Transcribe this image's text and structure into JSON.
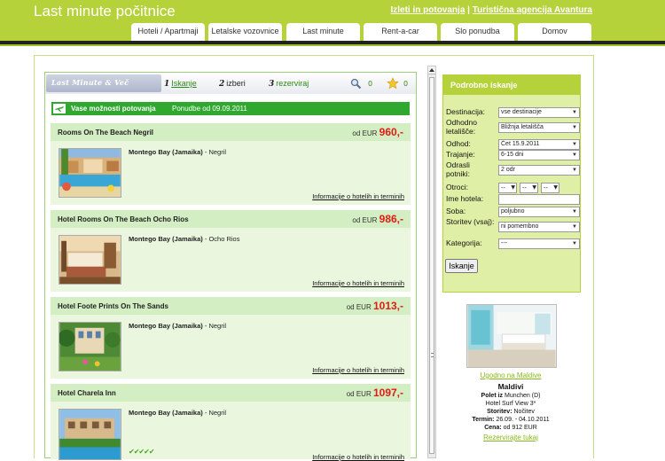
{
  "header": {
    "site_title": "Last minute počitnice",
    "links": [
      {
        "label": "Izleti in potovanja"
      },
      {
        "label": "Turistična agencija Avantura"
      }
    ],
    "separator": "|",
    "tabs": [
      {
        "label": "Hoteli / Apartmaji"
      },
      {
        "label": "Letalske vozovnice"
      },
      {
        "label": "Last minute"
      },
      {
        "label": "Rent-a-car"
      },
      {
        "label": "Slo ponudba"
      },
      {
        "label": "Domov"
      }
    ],
    "accent_color": "#b5d23a"
  },
  "panel": {
    "brand": "Last Minute & Več",
    "steps": [
      {
        "num": "1",
        "label": "Iskanje"
      },
      {
        "num": "2",
        "label": "izberi"
      },
      {
        "num": "3",
        "label": "rezerviraj"
      }
    ],
    "search_count": "0",
    "favorite_count": "0",
    "icons": [
      "plane-icon",
      "magnifier-icon",
      "star-icon"
    ],
    "options_title": "Vase možnosti potovanja",
    "options_date": "Ponudbe od 09.09.2011"
  },
  "offers": [
    {
      "title": "Rooms On The Beach Negril",
      "price_prefix": "od EUR",
      "price": "960,-",
      "location_bold": "Montego Bay (Jamaika)",
      "location_rest": " - Negril",
      "info_link": "Informacije o hotelih in terminih"
    },
    {
      "title": "Hotel Rooms On The Beach Ocho Rios",
      "price_prefix": "od EUR",
      "price": "986,-",
      "location_bold": "Montego Bay (Jamaika)",
      "location_rest": " - Ocho Rios",
      "info_link": "Informacije o hotelih in terminih"
    },
    {
      "title": "Hotel Foote Prints On The Sands",
      "price_prefix": "od EUR",
      "price": "1013,-",
      "location_bold": "Montego Bay (Jamaika)",
      "location_rest": " - Negril",
      "info_link": "Informacije o hotelih in terminih"
    },
    {
      "title": "Hotel Charela Inn",
      "price_prefix": "od EUR",
      "price": "1097,-",
      "location_bold": "Montego Bay (Jamaika)",
      "location_rest": " - Negril",
      "info_link": "Informacije o hotelih in terminih",
      "rating_marks": "✔✔✔✔✔"
    }
  ],
  "search_form": {
    "title": "Podrobno iskanje",
    "fields": [
      {
        "label": "Destinacija:",
        "value": "vse destinacije"
      },
      {
        "label": "Odhodno letališče:",
        "value": "Bližnja letališča"
      },
      {
        "label": "Odhod:",
        "value": "Čet 15.9.2011"
      },
      {
        "label": "Trajanje:",
        "value": "6-15 dni"
      },
      {
        "label": "Odrasli potniki:",
        "value": "2 odr"
      },
      {
        "label": "Otroci:",
        "value": "--"
      },
      {
        "label": "Ime hotela:",
        "value": ""
      },
      {
        "label": "Soba:",
        "value": "poljubno"
      },
      {
        "label": "Storitev (vsaj):",
        "value": "ni pomembno"
      },
      {
        "label": "Kategorija:",
        "value": "---"
      }
    ],
    "submit_label": "Iskanje"
  },
  "promo": {
    "link": "Ugodno na Maldive",
    "place": "Maldivi",
    "lines": [
      {
        "label": "Polet iz",
        "value": " Munchen (D)"
      },
      {
        "label": "",
        "value": "Hotel Surf View 3*"
      },
      {
        "label": "Storitev:",
        "value": " Nočitev"
      },
      {
        "label": "Termin:",
        "value": " 26.09. - 04.10.2011"
      },
      {
        "label": "Cena:",
        "value": " od 912 EUR"
      }
    ],
    "cta": "Rezervirajte tukaj"
  }
}
